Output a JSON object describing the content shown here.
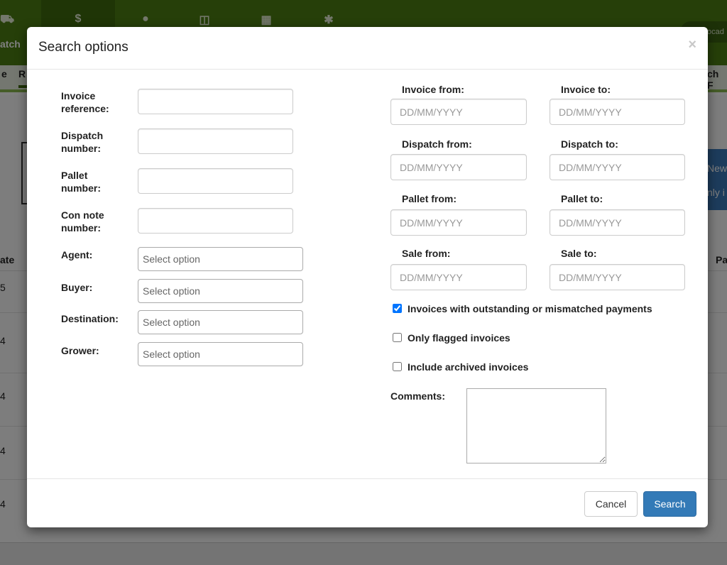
{
  "background": {
    "nav_label": "atch",
    "pill_text": "ocad",
    "subnav_left": "e",
    "subnav_r": "R",
    "subnav_right": "ch F",
    "blue_line1": "New",
    "blue_line2": "nly i",
    "th_left": "ate",
    "th_right": "Pa",
    "rows": [
      "5",
      "4",
      "4",
      "4",
      "4"
    ]
  },
  "modal": {
    "title": "Search options",
    "close_symbol": "×",
    "left_fields": [
      {
        "label": "Invoice reference:",
        "value": ""
      },
      {
        "label": "Dispatch number:",
        "value": ""
      },
      {
        "label": "Pallet number:",
        "value": ""
      },
      {
        "label": "Con note number:",
        "value": ""
      }
    ],
    "selects": [
      {
        "label": "Agent:",
        "value": "Select option"
      },
      {
        "label": "Buyer:",
        "value": "Select option"
      },
      {
        "label": "Destination:",
        "value": "Select option"
      },
      {
        "label": "Grower:",
        "value": "Select option"
      }
    ],
    "date_placeholder": "DD/MM/YYYY",
    "date_ranges": [
      {
        "from_label": "Invoice from:",
        "to_label": "Invoice to:"
      },
      {
        "from_label": "Dispatch from:",
        "to_label": "Dispatch to:"
      },
      {
        "from_label": "Pallet from:",
        "to_label": "Pallet to:"
      },
      {
        "from_label": "Sale from:",
        "to_label": "Sale to:"
      }
    ],
    "checkboxes": [
      {
        "label": "Invoices with outstanding or mismatched payments",
        "checked": true
      },
      {
        "label": "Only flagged invoices",
        "checked": false
      },
      {
        "label": "Include archived invoices",
        "checked": false
      }
    ],
    "comments_label": "Comments:",
    "comments_value": "",
    "cancel_label": "Cancel",
    "search_label": "Search",
    "accent_color": "#337ab7"
  }
}
